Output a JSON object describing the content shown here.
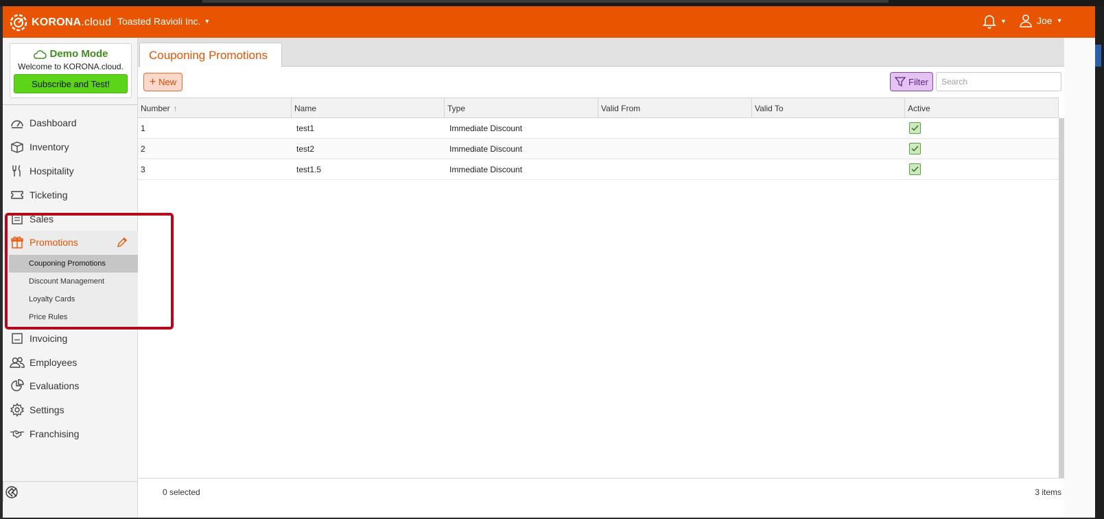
{
  "header": {
    "brand_bold": "KORONA",
    "brand_thin": ".cloud",
    "organization": "Toasted Ravioli Inc.",
    "user": "Joe"
  },
  "demo": {
    "title": "Demo Mode",
    "welcome": "Welcome to KORONA.cloud.",
    "button": "Subscribe and Test!"
  },
  "sidebar": {
    "items": [
      {
        "label": "Dashboard",
        "icon": "dashboard-icon"
      },
      {
        "label": "Inventory",
        "icon": "box-icon"
      },
      {
        "label": "Hospitality",
        "icon": "cutlery-icon"
      },
      {
        "label": "Ticketing",
        "icon": "ticket-icon"
      },
      {
        "label": "Sales",
        "icon": "receipt-icon"
      },
      {
        "label": "Promotions",
        "icon": "gift-icon"
      },
      {
        "label": "Invoicing",
        "icon": "invoice-icon"
      },
      {
        "label": "Employees",
        "icon": "people-icon"
      },
      {
        "label": "Evaluations",
        "icon": "pie-chart-icon"
      },
      {
        "label": "Settings",
        "icon": "gear-icon"
      },
      {
        "label": "Franchising",
        "icon": "handshake-icon"
      }
    ],
    "promotions_sub": [
      "Couponing Promotions",
      "Discount Management",
      "Loyalty Cards",
      "Price Rules"
    ]
  },
  "main": {
    "tab": "Couponing Promotions",
    "new_label": "New",
    "filter_label": "Filter",
    "search_placeholder": "Search",
    "columns": [
      "Number",
      "Name",
      "Type",
      "Valid From",
      "Valid To",
      "Active"
    ],
    "rows": [
      {
        "number": "1",
        "name": "test1",
        "type": "Immediate Discount",
        "valid_from": "",
        "valid_to": "",
        "active": true
      },
      {
        "number": "2",
        "name": "test2",
        "type": "Immediate Discount",
        "valid_from": "",
        "valid_to": "",
        "active": true
      },
      {
        "number": "3",
        "name": "test1.5",
        "type": "Immediate Discount",
        "valid_from": "",
        "valid_to": "",
        "active": true
      }
    ],
    "selected_text": "0 selected",
    "count_text": "3 items"
  },
  "colors": {
    "brand_orange": "#e85400",
    "demo_green": "#5bd419",
    "filter_purple": "#e3c3f2",
    "highlight_red": "#b5081d"
  }
}
